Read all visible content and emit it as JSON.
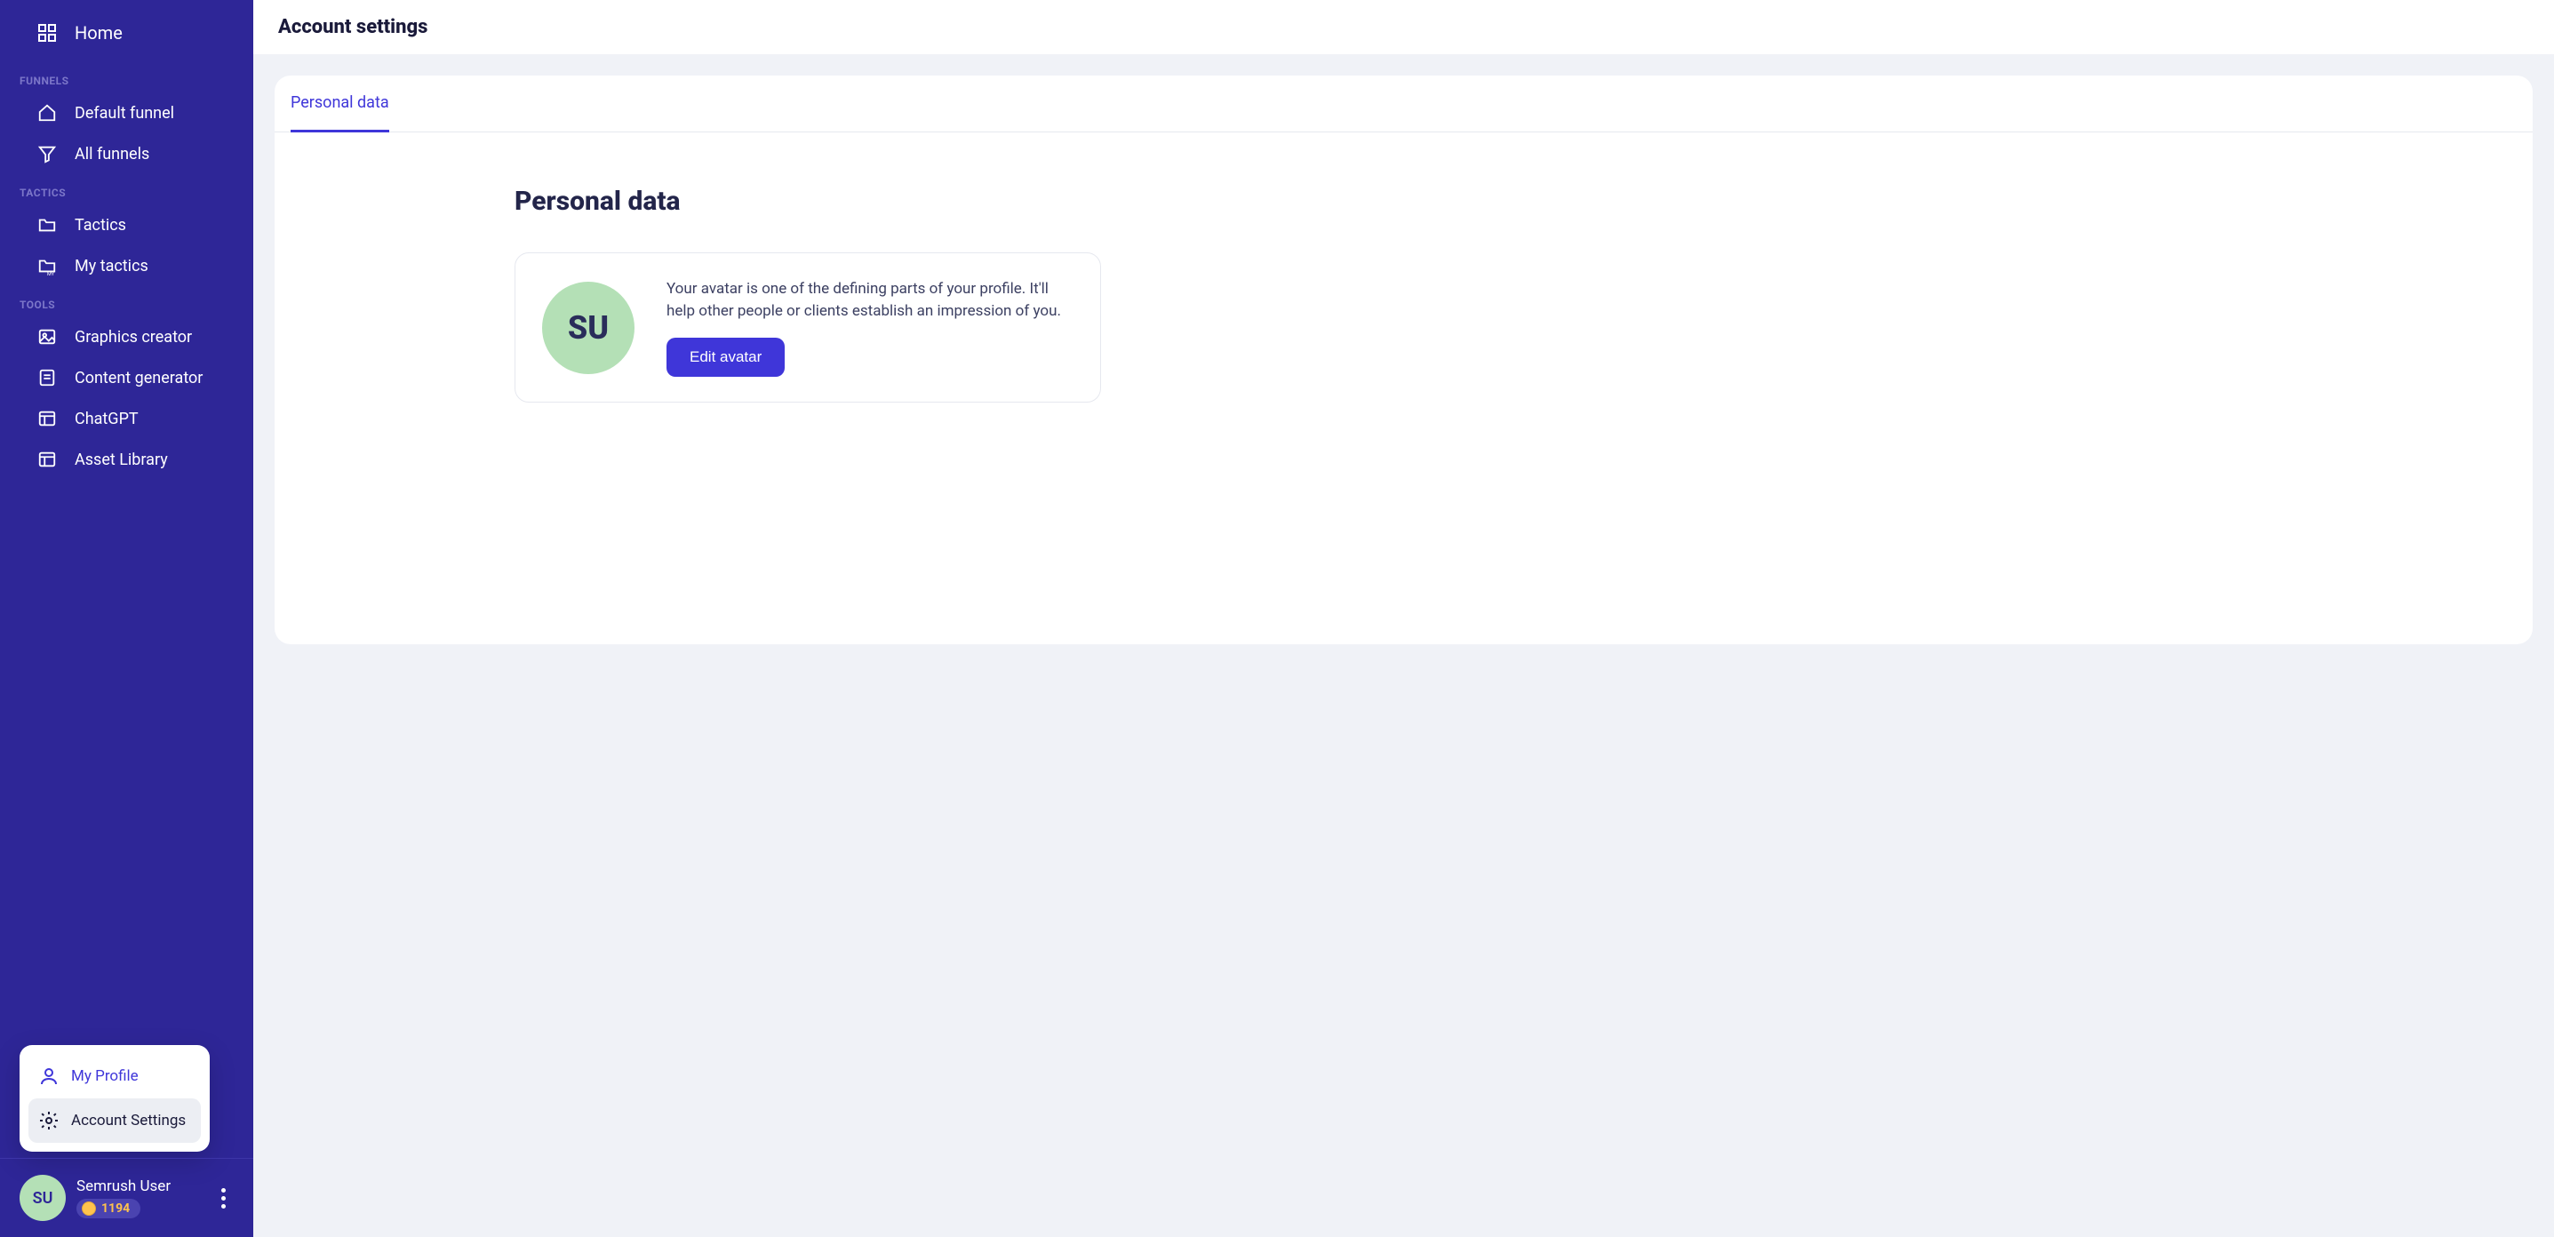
{
  "sidebar": {
    "home": "Home",
    "sections": {
      "funnels": {
        "label": "FUNNELS",
        "items": [
          {
            "label": "Default funnel"
          },
          {
            "label": "All funnels"
          }
        ]
      },
      "tactics": {
        "label": "TACTICS",
        "items": [
          {
            "label": "Tactics"
          },
          {
            "label": "My tactics"
          }
        ]
      },
      "tools": {
        "label": "TOOLS",
        "items": [
          {
            "label": "Graphics creator"
          },
          {
            "label": "Content generator"
          },
          {
            "label": "ChatGPT"
          },
          {
            "label": "Asset Library"
          }
        ]
      }
    },
    "popup": {
      "profile": "My Profile",
      "settings": "Account Settings"
    },
    "user": {
      "initials": "SU",
      "name": "Semrush User",
      "credits": "1194"
    }
  },
  "header": {
    "title": "Account settings"
  },
  "tabs": {
    "personal_data": "Personal data"
  },
  "panel": {
    "title": "Personal data",
    "avatar_initials": "SU",
    "avatar_desc": "Your avatar is one of the defining parts of your profile. It'll help other people or clients establish an impression of you.",
    "edit_avatar": "Edit avatar"
  }
}
